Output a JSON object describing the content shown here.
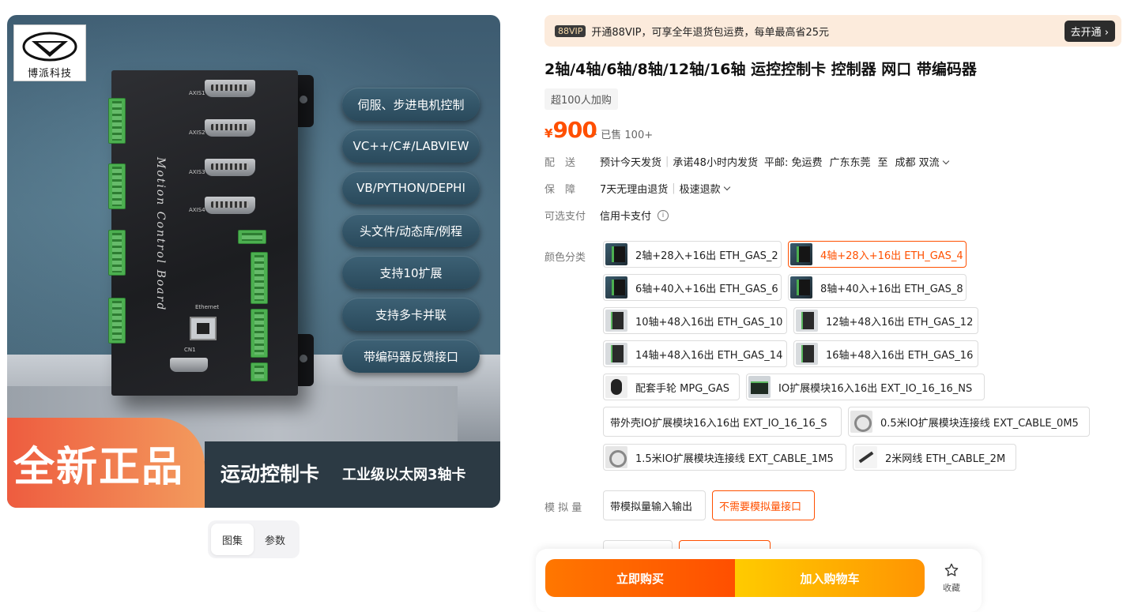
{
  "gallery": {
    "logo_text": "博派科技",
    "board_title": "Motion Control Board",
    "port_labels": [
      "AXIS1",
      "AXIS2",
      "AXIS3",
      "AXIS4",
      "Ethernet",
      "CN1"
    ],
    "features": [
      "伺服、步进电机控制",
      "VC++/C#/LABVIEW",
      "VB/PYTHON/DEPHI",
      "头文件/动态库/例程",
      "支持10扩展",
      "支持多卡并联",
      "带编码器反馈接口"
    ],
    "banner_big": "全新正品",
    "banner_sub1": "运动控制卡",
    "banner_sub2": "工业级以太网3轴卡"
  },
  "gallery_tabs": [
    {
      "label": "图集",
      "active": true
    },
    {
      "label": "参数",
      "active": false
    }
  ],
  "vip": {
    "badge": "88VIP",
    "text": "开通88VIP，可享全年退货包运费，每单最高省25元",
    "button": "去开通"
  },
  "product": {
    "title": "2轴/4轴/6轴/8轴/12轴/16轴 运控控制卡 控制器 网口 带编码器",
    "popularity": "超100人加购",
    "currency": "¥",
    "price": "900",
    "sold": "· 已售 100+"
  },
  "delivery": {
    "label": "配　送",
    "items": [
      "预计今天发货",
      "承诺48小时内发货"
    ],
    "shipping": "平邮: 免运费",
    "from": "广东东莞",
    "to_word": "至",
    "to": "成都 双流"
  },
  "guarantee": {
    "label": "保　障",
    "items": [
      "7天无理由退货",
      "极速退款"
    ]
  },
  "payment": {
    "label": "可选支付",
    "value": "信用卡支付",
    "info_icon": "i"
  },
  "color": {
    "label": "颜色分类",
    "options": [
      {
        "label": "2轴+28入+16出 ETH_GAS_2",
        "icon": "product-thumb-dark",
        "selected": false
      },
      {
        "label": "4轴+28入+16出 ETH_GAS_4",
        "icon": "product-thumb-dark",
        "selected": true
      },
      {
        "label": "6轴+40入+16出 ETH_GAS_6",
        "icon": "product-thumb-dark",
        "selected": false
      },
      {
        "label": "8轴+40入+16出 ETH_GAS_8",
        "icon": "product-thumb-dark",
        "selected": false
      },
      {
        "label": "10轴+48入16出 ETH_GAS_10",
        "icon": "product-thumb-grey",
        "selected": false
      },
      {
        "label": "12轴+48入16出 ETH_GAS_12",
        "icon": "product-thumb-grey",
        "selected": false
      },
      {
        "label": "14轴+48入16出 ETH_GAS_14",
        "icon": "product-thumb-grey",
        "selected": false
      },
      {
        "label": "16轴+48入16出 ETH_GAS_16",
        "icon": "product-thumb-grey",
        "selected": false
      },
      {
        "label": "配套手轮 MPG_GAS",
        "icon": "handwheel-thumb",
        "selected": false
      },
      {
        "label": "IO扩展模块16入16出 EXT_IO_16_16_NS",
        "icon": "io-module-thumb",
        "selected": false
      },
      {
        "label": "带外壳IO扩展模块16入16出 EXT_IO_16_16_S",
        "icon": "",
        "selected": false
      },
      {
        "label": "0.5米IO扩展模块连接线 EXT_CABLE_0M5",
        "icon": "cable-thumb",
        "selected": false
      },
      {
        "label": "1.5米IO扩展模块连接线 EXT_CABLE_1M5",
        "icon": "cable-thumb",
        "selected": false
      },
      {
        "label": "2米网线 ETH_CABLE_2M",
        "icon": "network-cable-thumb",
        "selected": false
      }
    ]
  },
  "analog": {
    "label": "模 拟 量",
    "options": [
      {
        "label": "带模拟量输入输出",
        "selected": false
      },
      {
        "label": "不需要模拟量接口",
        "selected": true
      }
    ]
  },
  "actions": {
    "buy_now": "立即购买",
    "add_cart": "加入购物车",
    "favorite": "收藏"
  },
  "colors": {
    "accent": "#ff5000",
    "vip_bg": "#fcebdc"
  }
}
